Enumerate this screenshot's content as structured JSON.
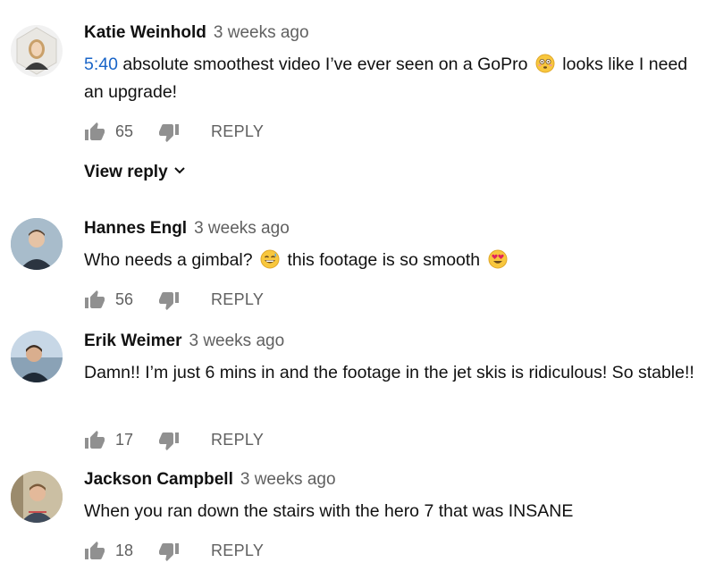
{
  "comments": [
    {
      "author": "Katie Weinhold",
      "time": "3 weeks ago",
      "timestamp_link": "5:40",
      "text_before_emoji": " absolute smoothest video I’ve ever seen on a GoPro ",
      "emoji": "flushed-face",
      "text_after_emoji": " looks like I need an upgrade!",
      "likes": "65",
      "reply_label": "REPLY",
      "view_reply_label": "View reply"
    },
    {
      "author": "Hannes Engl",
      "time": "3 weeks ago",
      "text_before_emoji": "Who needs a gimbal? ",
      "emoji": "grinning-sweat-face",
      "text_middle": " this footage is so smooth ",
      "emoji2": "heart-eyes-face",
      "likes": "56",
      "reply_label": "REPLY"
    },
    {
      "author": "Erik Weimer",
      "time": "3 weeks ago",
      "text": "Damn!! I’m just 6 mins in and the footage in the jet skis is ridiculous! So stable!!",
      "likes": "17",
      "reply_label": "REPLY"
    },
    {
      "author": "Jackson Campbell",
      "time": "3 weeks ago",
      "text": "When you ran down the stairs with the hero 7 that was INSANE",
      "likes": "18",
      "reply_label": "REPLY"
    }
  ],
  "colors": {
    "link": "#1a65c8",
    "secondary_text": "#606060",
    "icon": "#909090"
  }
}
